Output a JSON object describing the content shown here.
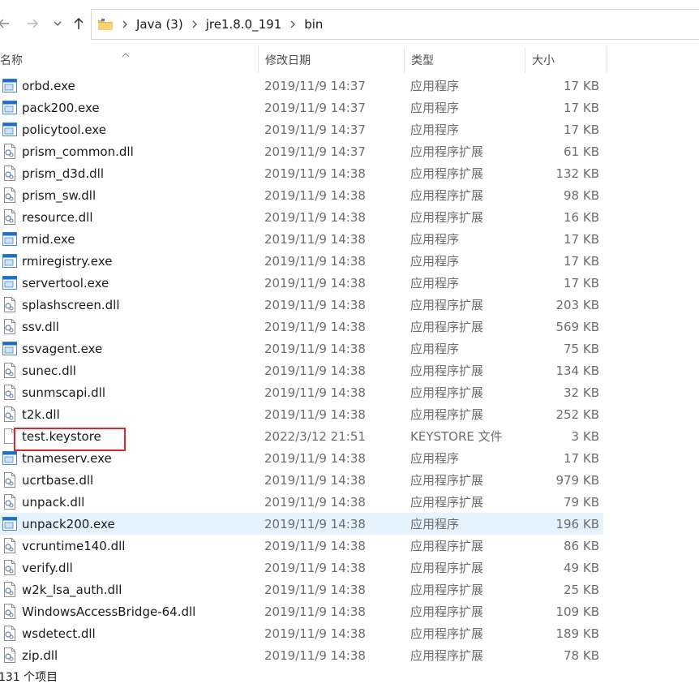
{
  "nav": {
    "breadcrumbs": [
      "Java (3)",
      "jre1.8.0_191",
      "bin"
    ]
  },
  "columns": {
    "name": "名称",
    "date": "修改日期",
    "type": "类型",
    "size": "大小"
  },
  "files": [
    {
      "name": "orbd.exe",
      "date": "2019/11/9 14:37",
      "type": "应用程序",
      "size": "17 KB",
      "icon": "exe-icon"
    },
    {
      "name": "pack200.exe",
      "date": "2019/11/9 14:37",
      "type": "应用程序",
      "size": "17 KB",
      "icon": "exe-icon"
    },
    {
      "name": "policytool.exe",
      "date": "2019/11/9 14:37",
      "type": "应用程序",
      "size": "17 KB",
      "icon": "exe-icon"
    },
    {
      "name": "prism_common.dll",
      "date": "2019/11/9 14:37",
      "type": "应用程序扩展",
      "size": "61 KB",
      "icon": "dll-icon"
    },
    {
      "name": "prism_d3d.dll",
      "date": "2019/11/9 14:38",
      "type": "应用程序扩展",
      "size": "132 KB",
      "icon": "dll-icon"
    },
    {
      "name": "prism_sw.dll",
      "date": "2019/11/9 14:38",
      "type": "应用程序扩展",
      "size": "98 KB",
      "icon": "dll-icon"
    },
    {
      "name": "resource.dll",
      "date": "2019/11/9 14:38",
      "type": "应用程序扩展",
      "size": "16 KB",
      "icon": "dll-icon"
    },
    {
      "name": "rmid.exe",
      "date": "2019/11/9 14:38",
      "type": "应用程序",
      "size": "17 KB",
      "icon": "exe-icon"
    },
    {
      "name": "rmiregistry.exe",
      "date": "2019/11/9 14:38",
      "type": "应用程序",
      "size": "17 KB",
      "icon": "exe-icon"
    },
    {
      "name": "servertool.exe",
      "date": "2019/11/9 14:38",
      "type": "应用程序",
      "size": "17 KB",
      "icon": "exe-icon"
    },
    {
      "name": "splashscreen.dll",
      "date": "2019/11/9 14:38",
      "type": "应用程序扩展",
      "size": "203 KB",
      "icon": "dll-icon"
    },
    {
      "name": "ssv.dll",
      "date": "2019/11/9 14:38",
      "type": "应用程序扩展",
      "size": "569 KB",
      "icon": "dll-icon"
    },
    {
      "name": "ssvagent.exe",
      "date": "2019/11/9 14:38",
      "type": "应用程序",
      "size": "75 KB",
      "icon": "exe-icon"
    },
    {
      "name": "sunec.dll",
      "date": "2019/11/9 14:38",
      "type": "应用程序扩展",
      "size": "134 KB",
      "icon": "dll-icon"
    },
    {
      "name": "sunmscapi.dll",
      "date": "2019/11/9 14:38",
      "type": "应用程序扩展",
      "size": "32 KB",
      "icon": "dll-icon"
    },
    {
      "name": "t2k.dll",
      "date": "2019/11/9 14:38",
      "type": "应用程序扩展",
      "size": "252 KB",
      "icon": "dll-icon"
    },
    {
      "name": "test.keystore",
      "date": "2022/3/12 21:51",
      "type": "KEYSTORE 文件",
      "size": "3 KB",
      "icon": "blank-file-icon"
    },
    {
      "name": "tnameserv.exe",
      "date": "2019/11/9 14:38",
      "type": "应用程序",
      "size": "17 KB",
      "icon": "exe-icon"
    },
    {
      "name": "ucrtbase.dll",
      "date": "2019/11/9 14:38",
      "type": "应用程序扩展",
      "size": "979 KB",
      "icon": "dll-icon"
    },
    {
      "name": "unpack.dll",
      "date": "2019/11/9 14:38",
      "type": "应用程序扩展",
      "size": "79 KB",
      "icon": "dll-icon"
    },
    {
      "name": "unpack200.exe",
      "date": "2019/11/9 14:38",
      "type": "应用程序",
      "size": "196 KB",
      "icon": "exe-icon",
      "selected": true
    },
    {
      "name": "vcruntime140.dll",
      "date": "2019/11/9 14:38",
      "type": "应用程序扩展",
      "size": "86 KB",
      "icon": "dll-icon"
    },
    {
      "name": "verify.dll",
      "date": "2019/11/9 14:38",
      "type": "应用程序扩展",
      "size": "49 KB",
      "icon": "dll-icon"
    },
    {
      "name": "w2k_lsa_auth.dll",
      "date": "2019/11/9 14:38",
      "type": "应用程序扩展",
      "size": "25 KB",
      "icon": "dll-icon"
    },
    {
      "name": "WindowsAccessBridge-64.dll",
      "date": "2019/11/9 14:38",
      "type": "应用程序扩展",
      "size": "109 KB",
      "icon": "dll-icon"
    },
    {
      "name": "wsdetect.dll",
      "date": "2019/11/9 14:38",
      "type": "应用程序扩展",
      "size": "189 KB",
      "icon": "dll-icon"
    },
    {
      "name": "zip.dll",
      "date": "2019/11/9 14:38",
      "type": "应用程序扩展",
      "size": "78 KB",
      "icon": "dll-icon"
    }
  ],
  "status": {
    "item_count": "131 个项目"
  },
  "colors": {
    "selected_row": "#e5f3ff",
    "highlight_box": "#e0262c",
    "exe_icon": "#1e6fc9"
  }
}
